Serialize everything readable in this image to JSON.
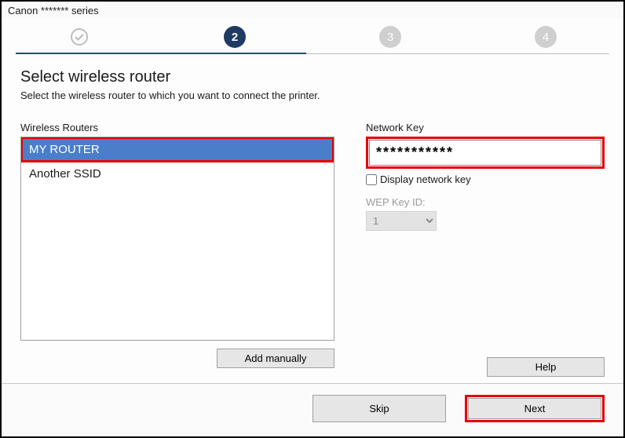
{
  "window": {
    "title": "Canon ******* series"
  },
  "stepper": {
    "step2": "2",
    "step3": "3",
    "step4": "4",
    "active": 2
  },
  "page": {
    "heading": "Select wireless router",
    "subtitle": "Select the wireless router to which you want to connect the printer."
  },
  "routers": {
    "label": "Wireless Routers",
    "items": [
      {
        "ssid": "MY ROUTER",
        "selected": true
      },
      {
        "ssid": "Another SSID",
        "selected": false
      }
    ],
    "add_manually_label": "Add manually"
  },
  "network_key": {
    "label": "Network Key",
    "value": "***********",
    "display_checkbox_label": "Display network key",
    "display_checked": false
  },
  "wep": {
    "label": "WEP Key ID:",
    "value": "1"
  },
  "help_label": "Help",
  "footer": {
    "skip_label": "Skip",
    "next_label": "Next"
  }
}
